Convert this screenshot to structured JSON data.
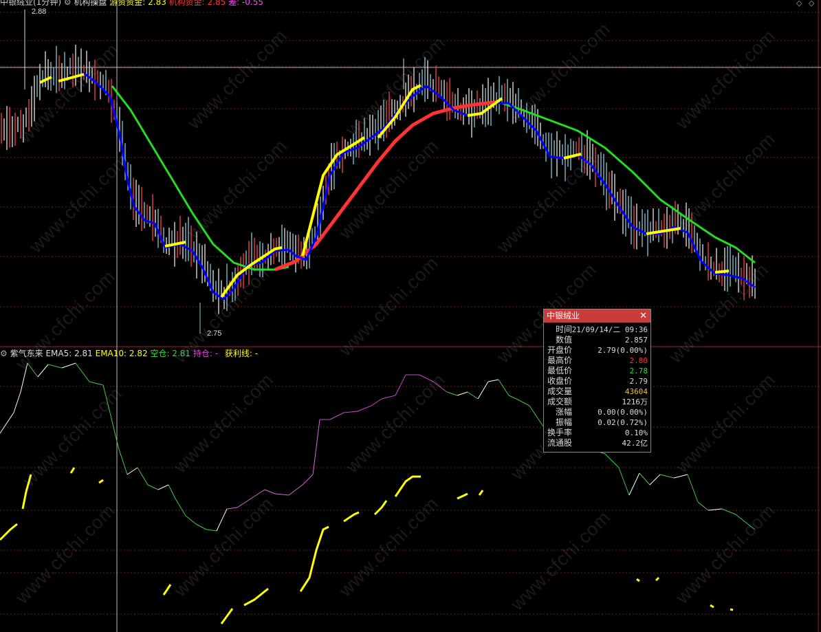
{
  "top_header": {
    "title": "中银绒业(1分钟)",
    "indicator_name": "机构操盘",
    "items": [
      {
        "label": "游资资金: 2.83",
        "color": "#ffff00"
      },
      {
        "label": "机构资金: 2.85",
        "color": "#ff3333"
      },
      {
        "label": "差: -0.55",
        "color": "#ff44ff"
      }
    ]
  },
  "price_labels": {
    "high": "2.88",
    "low": "2.75"
  },
  "sub_header": {
    "name": "紫气东来",
    "ema5": "EMA5: 2.81",
    "ema10": "EMA10: 2.82",
    "kongcang": "空仓: 2.81",
    "chicang": "持仓: -",
    "huolixian": "获利线: -"
  },
  "info_panel": {
    "title": "中银绒业",
    "rows": [
      {
        "k": "时间",
        "v": "21/09/14/二 09:36",
        "color": "#dddddd"
      },
      {
        "k": "数值",
        "v": "2.857",
        "color": "#dddddd"
      },
      {
        "k": "开盘价",
        "v": "2.79(0.00%)",
        "color": "#dddddd"
      },
      {
        "k": "最高价",
        "v": "2.80",
        "color": "#ff3333"
      },
      {
        "k": "最低价",
        "v": "2.78",
        "color": "#33dd33"
      },
      {
        "k": "收盘价",
        "v": "2.79",
        "color": "#dddddd"
      },
      {
        "k": "成交量",
        "v": "43604",
        "color": "#e8c83a"
      },
      {
        "k": "成交额",
        "v": "1216万",
        "color": "#dddddd"
      },
      {
        "k": "涨幅",
        "v": "0.00(0.00%)",
        "color": "#dddddd"
      },
      {
        "k": "振幅",
        "v": "0.02(0.72%)",
        "color": "#dddddd"
      },
      {
        "k": "换手率",
        "v": "0.10%",
        "color": "#dddddd"
      },
      {
        "k": "流通股",
        "v": "42.2亿",
        "color": "#dddddd"
      }
    ]
  },
  "watermark": "www.cfchi.com",
  "colors": {
    "grid": "#7a1818",
    "up": "#ff3333",
    "fast_line": "#0000ff",
    "slow_line": "#22dd22",
    "yellow": "#ffff00",
    "purple": "#cc44cc",
    "green": "#44cc44"
  },
  "close_icon": "close-icon",
  "window_icons": [
    "diamond-icon",
    "diamond-icon"
  ]
}
